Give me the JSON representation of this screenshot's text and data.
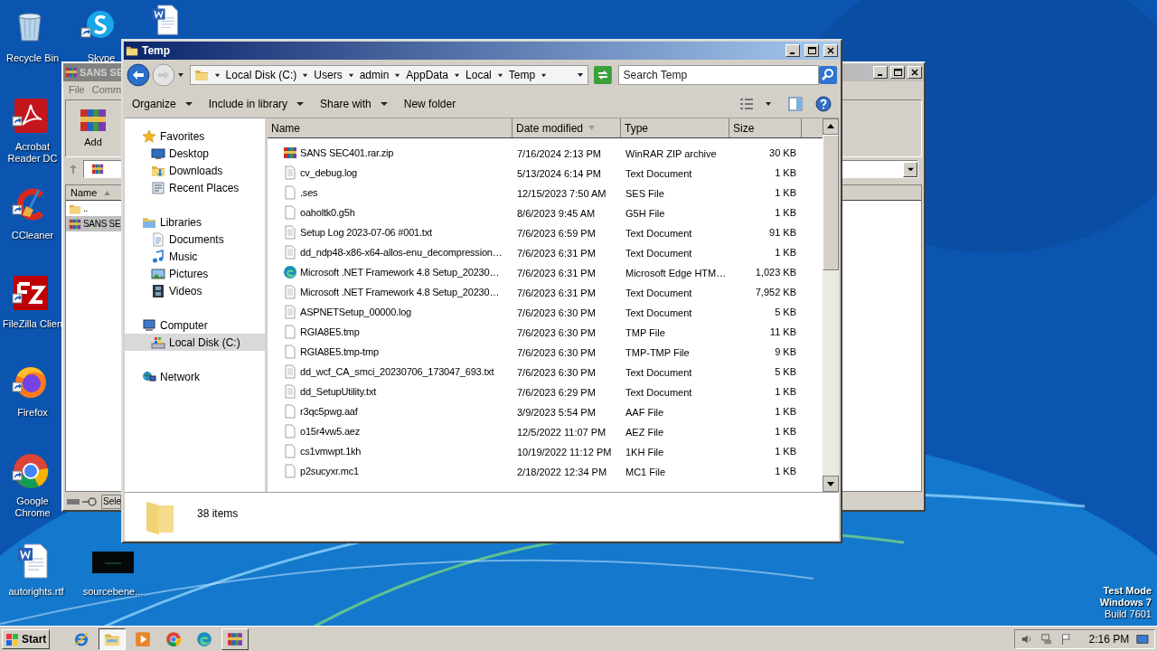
{
  "desktop": {
    "icons": [
      {
        "label": "Recycle Bin",
        "kind": "recycle"
      },
      {
        "label": "Skype",
        "kind": "chat"
      },
      {
        "kind": "worddoc"
      },
      {
        "label": "Acrobat Reader DC",
        "kind": "pdf"
      },
      {
        "label": "CCleaner",
        "kind": "cleaner"
      },
      {
        "label": "FileZilla Clien",
        "kind": "ftp"
      },
      {
        "label": "Firefox",
        "kind": "firefox"
      },
      {
        "label": "Google Chrome",
        "kind": "chrome"
      },
      {
        "label": "autorights.rtf",
        "kind": "worddoc"
      },
      {
        "label": "sourcebene...",
        "kind": "thumb"
      }
    ],
    "os_notice": [
      "Test Mode",
      "Windows 7",
      "Build 7601"
    ]
  },
  "archiver_window": {
    "title": "SANS SE",
    "menu": [
      "File",
      "Comm"
    ],
    "tool": "Add",
    "column": "Name",
    "rows": [
      {
        "name": "..",
        "kind": "folder",
        "selected": false
      },
      {
        "name": "SANS SE",
        "kind": "archive",
        "selected": true
      }
    ],
    "status": "Sele"
  },
  "explorer": {
    "title": "Temp",
    "breadcrumb": [
      "Local Disk (C:)",
      "Users",
      "admin",
      "AppData",
      "Local",
      "Temp"
    ],
    "search": {
      "placeholder": "Search Temp"
    },
    "toolbar": [
      {
        "label": "Organize",
        "dropdown": true
      },
      {
        "label": "Include in library",
        "dropdown": true
      },
      {
        "label": "Share with",
        "dropdown": true
      },
      {
        "label": "New folder",
        "dropdown": false
      }
    ],
    "nav": [
      {
        "label": "Favorites",
        "kind": "star",
        "selected": false,
        "children": [
          {
            "label": "Desktop",
            "kind": "desktop",
            "selected": false
          },
          {
            "label": "Downloads",
            "kind": "downloads",
            "selected": false
          },
          {
            "label": "Recent Places",
            "kind": "recent",
            "selected": false
          }
        ]
      },
      {
        "label": "Libraries",
        "kind": "library",
        "selected": false,
        "children": [
          {
            "label": "Documents",
            "kind": "document",
            "selected": false
          },
          {
            "label": "Music",
            "kind": "music",
            "selected": false
          },
          {
            "label": "Pictures",
            "kind": "pictures",
            "selected": false
          },
          {
            "label": "Videos",
            "kind": "videos",
            "selected": false
          }
        ]
      },
      {
        "label": "Computer",
        "kind": "computer",
        "selected": false,
        "children": [
          {
            "label": "Local Disk (C:)",
            "kind": "drive",
            "selected": true
          }
        ]
      },
      {
        "label": "Network",
        "kind": "network",
        "selected": false
      }
    ],
    "columns": [
      {
        "label": "Name",
        "sorted": false
      },
      {
        "label": "Date modified",
        "sorted": true
      },
      {
        "label": "Type",
        "sorted": false
      },
      {
        "label": "Size",
        "sorted": false
      }
    ],
    "files": [
      {
        "name": "SANS SEC401.rar.zip",
        "date": "7/16/2024 2:13 PM",
        "type": "WinRAR ZIP archive",
        "size": "30 KB",
        "kind": "archive"
      },
      {
        "name": "cv_debug.log",
        "date": "5/13/2024 6:14 PM",
        "type": "Text Document",
        "size": "1 KB",
        "kind": "text"
      },
      {
        "name": ".ses",
        "date": "12/15/2023 7:50 AM",
        "type": "SES File",
        "size": "1 KB",
        "kind": "blank"
      },
      {
        "name": "oaholtk0.g5h",
        "date": "8/6/2023 9:45 AM",
        "type": "G5H File",
        "size": "1 KB",
        "kind": "blank"
      },
      {
        "name": "Setup Log 2023-07-06 #001.txt",
        "date": "7/6/2023 6:59 PM",
        "type": "Text Document",
        "size": "91 KB",
        "kind": "text"
      },
      {
        "name": "dd_ndp48-x86-x64-allos-enu_decompression…",
        "date": "7/6/2023 6:31 PM",
        "type": "Text Document",
        "size": "1 KB",
        "kind": "text"
      },
      {
        "name": "Microsoft .NET Framework 4.8 Setup_20230…",
        "date": "7/6/2023 6:31 PM",
        "type": "Microsoft Edge HTM…",
        "size": "1,023 KB",
        "kind": "edge"
      },
      {
        "name": "Microsoft .NET Framework 4.8 Setup_20230…",
        "date": "7/6/2023 6:31 PM",
        "type": "Text Document",
        "size": "7,952 KB",
        "kind": "text"
      },
      {
        "name": "ASPNETSetup_00000.log",
        "date": "7/6/2023 6:30 PM",
        "type": "Text Document",
        "size": "5 KB",
        "kind": "text"
      },
      {
        "name": "RGIA8E5.tmp",
        "date": "7/6/2023 6:30 PM",
        "type": "TMP File",
        "size": "11 KB",
        "kind": "blank"
      },
      {
        "name": "RGIA8E5.tmp-tmp",
        "date": "7/6/2023 6:30 PM",
        "type": "TMP-TMP File",
        "size": "9 KB",
        "kind": "blank"
      },
      {
        "name": "dd_wcf_CA_smci_20230706_173047_693.txt",
        "date": "7/6/2023 6:30 PM",
        "type": "Text Document",
        "size": "5 KB",
        "kind": "text"
      },
      {
        "name": "dd_SetupUtility.txt",
        "date": "7/6/2023 6:29 PM",
        "type": "Text Document",
        "size": "1 KB",
        "kind": "text"
      },
      {
        "name": "r3qc5pwg.aaf",
        "date": "3/9/2023 5:54 PM",
        "type": "AAF File",
        "size": "1 KB",
        "kind": "blank"
      },
      {
        "name": "o15r4vw5.aez",
        "date": "12/5/2022 11:07 PM",
        "type": "AEZ File",
        "size": "1 KB",
        "kind": "blank"
      },
      {
        "name": "cs1vmwpt.1kh",
        "date": "10/19/2022 11:12 PM",
        "type": "1KH File",
        "size": "1 KB",
        "kind": "blank"
      },
      {
        "name": "p2sucyxr.mc1",
        "date": "2/18/2022 12:34 PM",
        "type": "MC1 File",
        "size": "1 KB",
        "kind": "blank"
      }
    ],
    "status": "38 items"
  },
  "taskbar": {
    "start": "Start",
    "apps": [
      {
        "kind": "ie",
        "selected": false,
        "running": false
      },
      {
        "kind": "explorer",
        "selected": true,
        "running": true
      },
      {
        "kind": "media",
        "selected": false,
        "running": false
      },
      {
        "kind": "chrome",
        "selected": false,
        "running": false
      },
      {
        "kind": "edge",
        "selected": false,
        "running": false
      },
      {
        "kind": "archive",
        "selected": false,
        "running": true
      }
    ],
    "clock": "2:16 PM"
  }
}
